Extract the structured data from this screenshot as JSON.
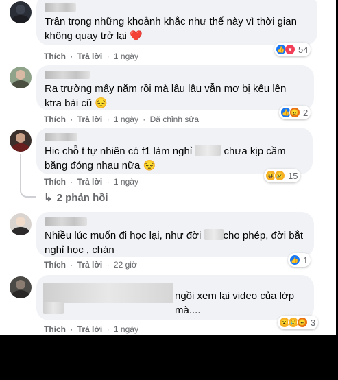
{
  "comments": [
    {
      "text": "Trân trọng những khoảnh khắc như thế này vì thời gian không quay trở lại ❤️",
      "like_label": "Thích",
      "reply_label": "Trả lời",
      "time": "1 ngày",
      "edited": "",
      "reaction_count": "54",
      "reactions": [
        "like-icon",
        "love-icon"
      ]
    },
    {
      "text": "Ra trường mấy năm rồi mà lâu lâu vẫn mơ bị kêu lên ktra bài cũ 😔",
      "like_label": "Thích",
      "reply_label": "Trả lời",
      "time": "1 ngày",
      "edited": "Đã chỉnh sửa",
      "reaction_count": "2",
      "reactions": [
        "like-icon",
        "angry-icon"
      ]
    },
    {
      "text_before": "Hic chỗ t tự nhiên có f1 làm nghỉ ",
      "text_after": " chưa kịp cầm băng đóng nhau nữa 😔",
      "like_label": "Thích",
      "reply_label": "Trả lời",
      "time": "1 ngày",
      "edited": "",
      "reaction_count": "15",
      "reactions": [
        "haha-icon",
        "sad-icon"
      ],
      "replies_label": "2 phản hồi"
    },
    {
      "text_before": "Nhiều lúc muốn đi học lại, như đời ",
      "text_after": "cho phép, đời bắt nghỉ học , chán",
      "like_label": "Thích",
      "reply_label": "Trả lời",
      "time": "22 giờ",
      "edited": "",
      "reaction_count": "1",
      "reactions": [
        "like-icon"
      ]
    },
    {
      "text_after": "ngồi xem lại video của lớp mà....",
      "like_label": "Thích",
      "reply_label": "Trả lời",
      "time": "1 ngày",
      "edited": "",
      "reaction_count": "3",
      "reactions": [
        "wow-icon",
        "sad-icon",
        "angry-icon"
      ]
    }
  ],
  "separator": "·",
  "colors": {
    "bubble_bg": "#f0f2f5",
    "meta_text": "#65676b",
    "like_blue": "#1877f2",
    "love_red": "#f33e58"
  }
}
